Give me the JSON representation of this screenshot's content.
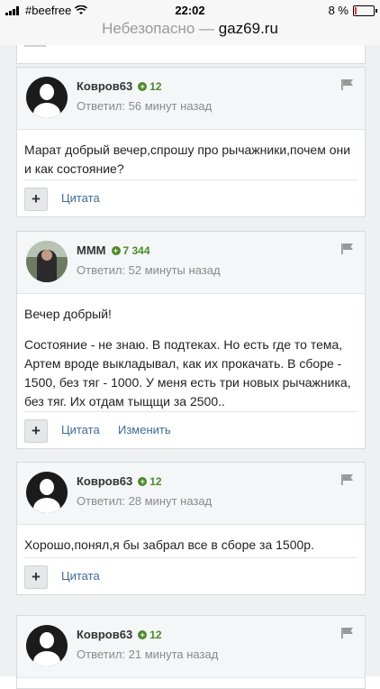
{
  "status_bar": {
    "carrier": "#beefree",
    "time": "22:02",
    "battery": "8 %",
    "battery_level": 0.08
  },
  "url_bar": {
    "insecure_label": "Небезопасно —",
    "domain": "gaz69.ru"
  },
  "posts": [
    {
      "author": "Ковров63",
      "reputation": "12",
      "time": "Ответил: 56 минут назад",
      "body": [
        "Марат добрый вечер,спрошу про рычажники,почем они и как состояние?"
      ],
      "actions": [
        "Цитата"
      ]
    },
    {
      "author": "MMM",
      "reputation": "7 344",
      "time": "Ответил: 52 минуты назад",
      "body": [
        "Вечер добрый!",
        "Состояние - не знаю. В подтеках. Но есть где то тема, Артем вроде выкладывал, как их прокачать. В сборе - 1500, без тяг - 1000.  У меня есть три новых рычажника, без тяг. Их отдам тыщщи за 2500.."
      ],
      "actions": [
        "Цитата",
        "Изменить"
      ]
    },
    {
      "author": "Ковров63",
      "reputation": "12",
      "time": "Ответил: 28 минут назад",
      "body": [
        "Хорошо,понял,я бы забрал все в сборе за 1500р."
      ],
      "actions": [
        "Цитата"
      ]
    },
    {
      "author": "Ковров63",
      "reputation": "12",
      "time": "Ответил: 21 минута назад",
      "body": [],
      "actions": []
    }
  ]
}
